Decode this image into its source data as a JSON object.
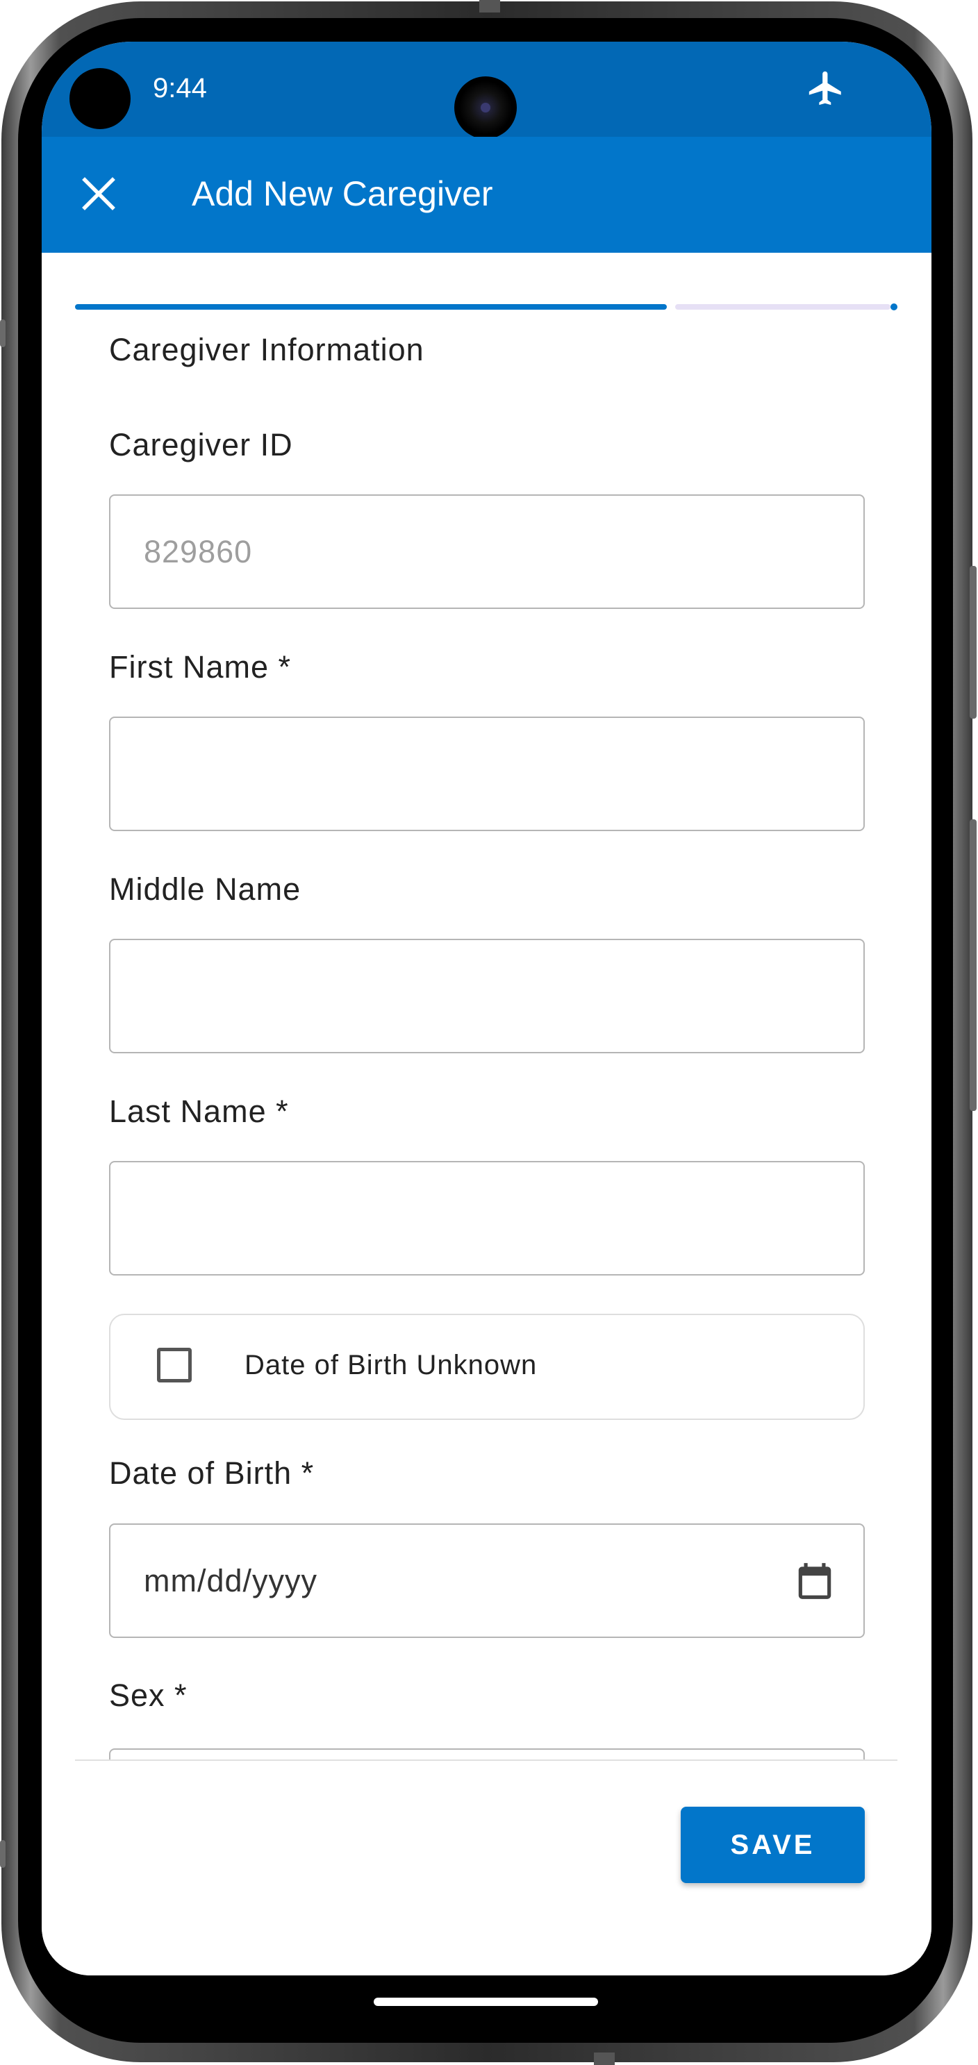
{
  "status_bar": {
    "time": "9:44",
    "icon": "airplane-icon"
  },
  "app_bar": {
    "title": "Add New Caregiver",
    "close_icon": "close-icon"
  },
  "progress": {
    "completed_fraction": 0.73,
    "accent": "#0276CA",
    "track_color": "#E6E0F5"
  },
  "form": {
    "section_title": "Caregiver Information",
    "caregiver_id": {
      "label": "Caregiver ID",
      "placeholder": "829860"
    },
    "first_name": {
      "label": "First Name *",
      "value": ""
    },
    "middle_name": {
      "label": "Middle Name",
      "value": ""
    },
    "last_name": {
      "label": "Last Name *",
      "value": ""
    },
    "dob_unknown": {
      "label": "Date of Birth Unknown",
      "checked": false
    },
    "dob": {
      "label": "Date of Birth *",
      "placeholder": "mm/dd/yyyy",
      "icon": "calendar-icon"
    },
    "sex": {
      "label": "Sex *"
    }
  },
  "footer": {
    "save_label": "SAVE"
  },
  "colors": {
    "status_bar": "#0268B5",
    "app_bar": "#0276CA",
    "primary": "#0276CA"
  }
}
